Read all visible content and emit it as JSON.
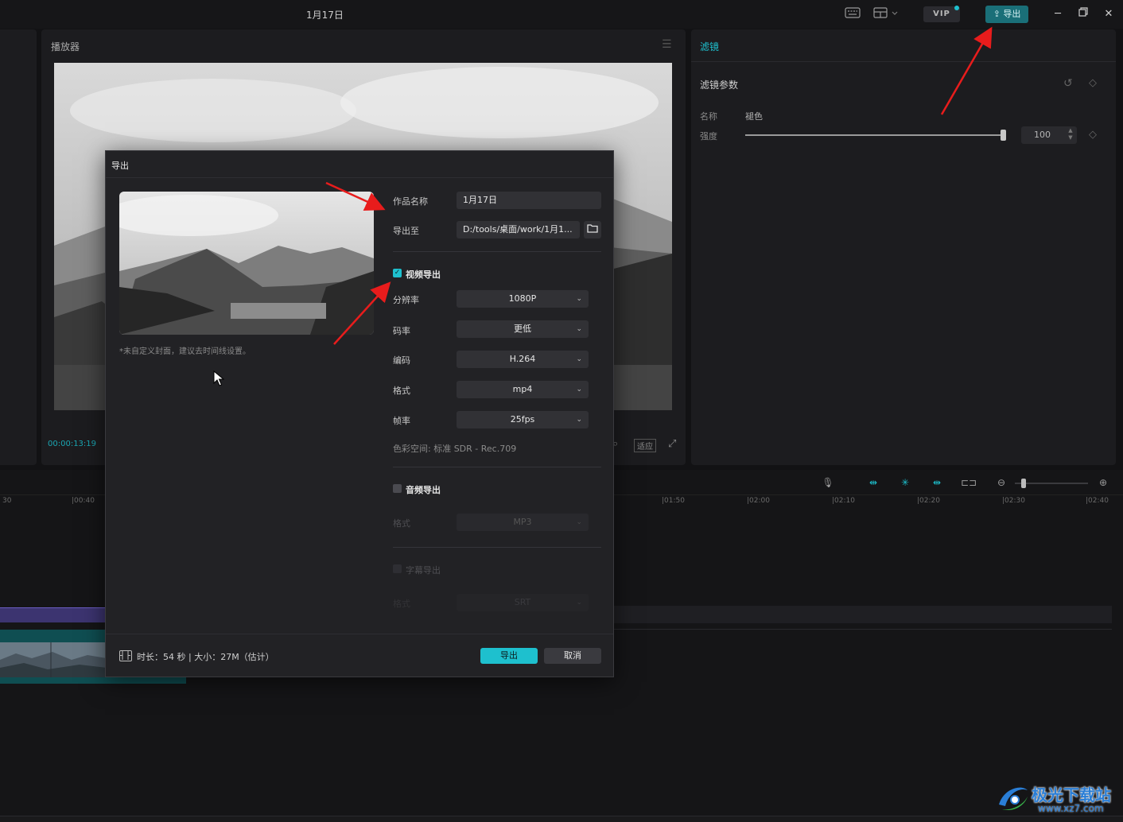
{
  "window": {
    "title": "1月17日",
    "top_export_label": "导出",
    "vip_label": "VIP",
    "icons": [
      "keyboard-icon",
      "layout-icon",
      "minimize-icon",
      "restore-icon",
      "close-icon"
    ]
  },
  "player": {
    "title": "播放器",
    "timecode": "00:00:13:19",
    "fit_label": "适应"
  },
  "filter_panel": {
    "tab": "滤镜",
    "params_title": "滤镜参数",
    "name_label": "名称",
    "name_value": "褪色",
    "strength_label": "强度",
    "strength_value": "100",
    "strength_fraction": 1.0
  },
  "timeline": {
    "ruler": [
      "30",
      "|00:40",
      "|01:50",
      "|02:00",
      "|02:10",
      "|02:20",
      "|02:30",
      "|02:40"
    ]
  },
  "dialog": {
    "title": "导出",
    "cover_hint": "*未自定义封面，建议去时间线设置。",
    "name_label": "作品名称",
    "name_value": "1月17日",
    "path_label": "导出至",
    "path_value": "D:/tools/桌面/work/1月1...",
    "video_section": "视频导出",
    "resolution_label": "分辨率",
    "resolution_value": "1080P",
    "bitrate_label": "码率",
    "bitrate_value": "更低",
    "codec_label": "编码",
    "codec_value": "H.264",
    "format_label": "格式",
    "format_value": "mp4",
    "fps_label": "帧率",
    "fps_value": "25fps",
    "colorspace": "色彩空间:  标准 SDR - Rec.709",
    "audio_section": "音频导出",
    "audio_format_label": "格式",
    "audio_format_value": "MP3",
    "subtitle_section": "字幕导出",
    "subtitle_format_label": "格式",
    "subtitle_format_value": "SRT",
    "summary": "时长：54 秒 | 大小：27M（估计）",
    "export_button": "导出",
    "cancel_button": "取消"
  },
  "watermark": {
    "title": "极光下载站",
    "url": "www.xz7.com"
  },
  "colors": {
    "accent": "#1ec0ce",
    "annotation_arrow": "#e81c1c"
  }
}
